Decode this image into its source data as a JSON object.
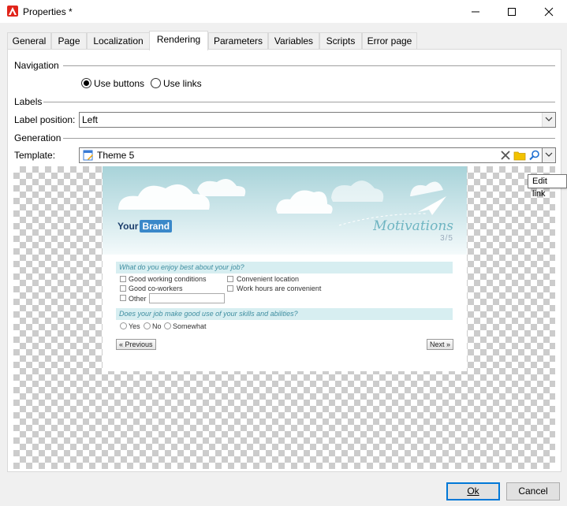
{
  "window": {
    "title": "Properties *"
  },
  "tabs": [
    {
      "label": "General"
    },
    {
      "label": "Page"
    },
    {
      "label": "Localization"
    },
    {
      "label": "Rendering"
    },
    {
      "label": "Parameters"
    },
    {
      "label": "Variables"
    },
    {
      "label": "Scripts"
    },
    {
      "label": "Error page"
    }
  ],
  "navigation": {
    "section": "Navigation",
    "use_buttons": "Use buttons",
    "use_links": "Use links",
    "selected": "Use buttons"
  },
  "labels": {
    "section": "Labels",
    "label_position_label": "Label position:",
    "label_position_value": "Left"
  },
  "generation": {
    "section": "Generation",
    "template_label": "Template:",
    "template_value": "Theme 5",
    "tooltip": "Edit link"
  },
  "preview": {
    "brand_your": "Your",
    "brand_name": "Brand",
    "title": "Motivations",
    "page": "3/5",
    "q1": "What do you enjoy best about your job?",
    "q1_options": [
      "Good working conditions",
      "Good co-workers",
      "Other",
      "Convenient location",
      "Work hours are convenient"
    ],
    "q2": "Does your job make good use of your skills and abilities?",
    "q2_options": [
      "Yes",
      "No",
      "Somewhat"
    ],
    "prev": "« Previous",
    "next": "Next »"
  },
  "footer": {
    "ok": "Ok",
    "cancel": "Cancel"
  },
  "colors": {
    "accent": "#0078d7",
    "app_icon": "#e1251b"
  }
}
